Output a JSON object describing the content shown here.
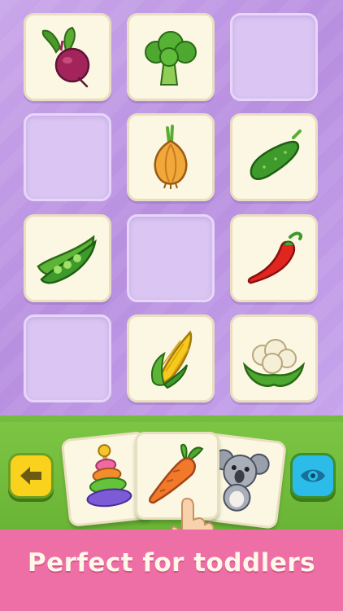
{
  "screen": {
    "background": "#c2a0e8",
    "grid": {
      "rows": [
        [
          "beet",
          "broccoli",
          "empty"
        ],
        [
          "empty",
          "onion",
          "cucumber"
        ],
        [
          "peas",
          "empty",
          "chili-pepper"
        ],
        [
          "empty",
          "corn",
          "cauliflower"
        ]
      ]
    }
  },
  "tray": {
    "color": "#73bd3e",
    "cards": [
      "pyramid-toy",
      "carrot",
      "koala"
    ],
    "back_button_icon": "arrow-left-icon",
    "eye_button_icon": "eye-icon"
  },
  "banner": {
    "title": "Perfect for toddlers",
    "color": "#ee6ea6"
  }
}
